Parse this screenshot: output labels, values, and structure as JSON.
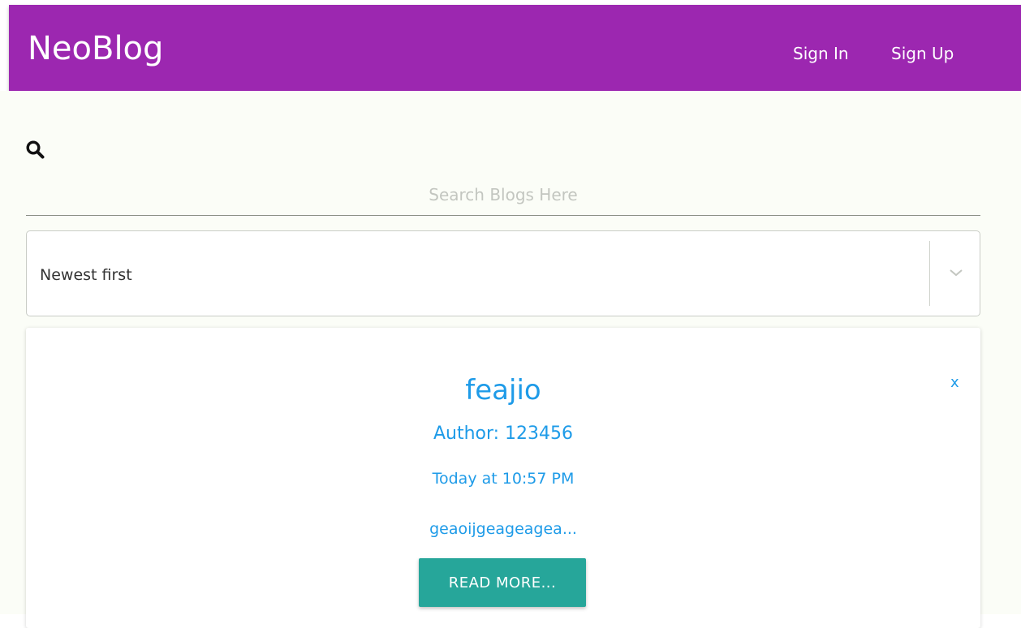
{
  "navbar": {
    "brand": "NeoBlog",
    "sign_in": "Sign In",
    "sign_up": "Sign Up",
    "color": "#9c27b0"
  },
  "search": {
    "icon": "search-icon",
    "placeholder": "Search Blogs Here",
    "value": ""
  },
  "sort": {
    "selected": "Newest first",
    "icon": "chevron-down-icon"
  },
  "posts": [
    {
      "title": "feajio",
      "author": "Author: 123456",
      "date": "Today at 10:57 PM",
      "excerpt": "geaoijgeageagea...",
      "close_label": "x",
      "read_more_label": "READ MORE...",
      "link_color": "#1e9be8",
      "button_color": "#26a69a"
    }
  ]
}
